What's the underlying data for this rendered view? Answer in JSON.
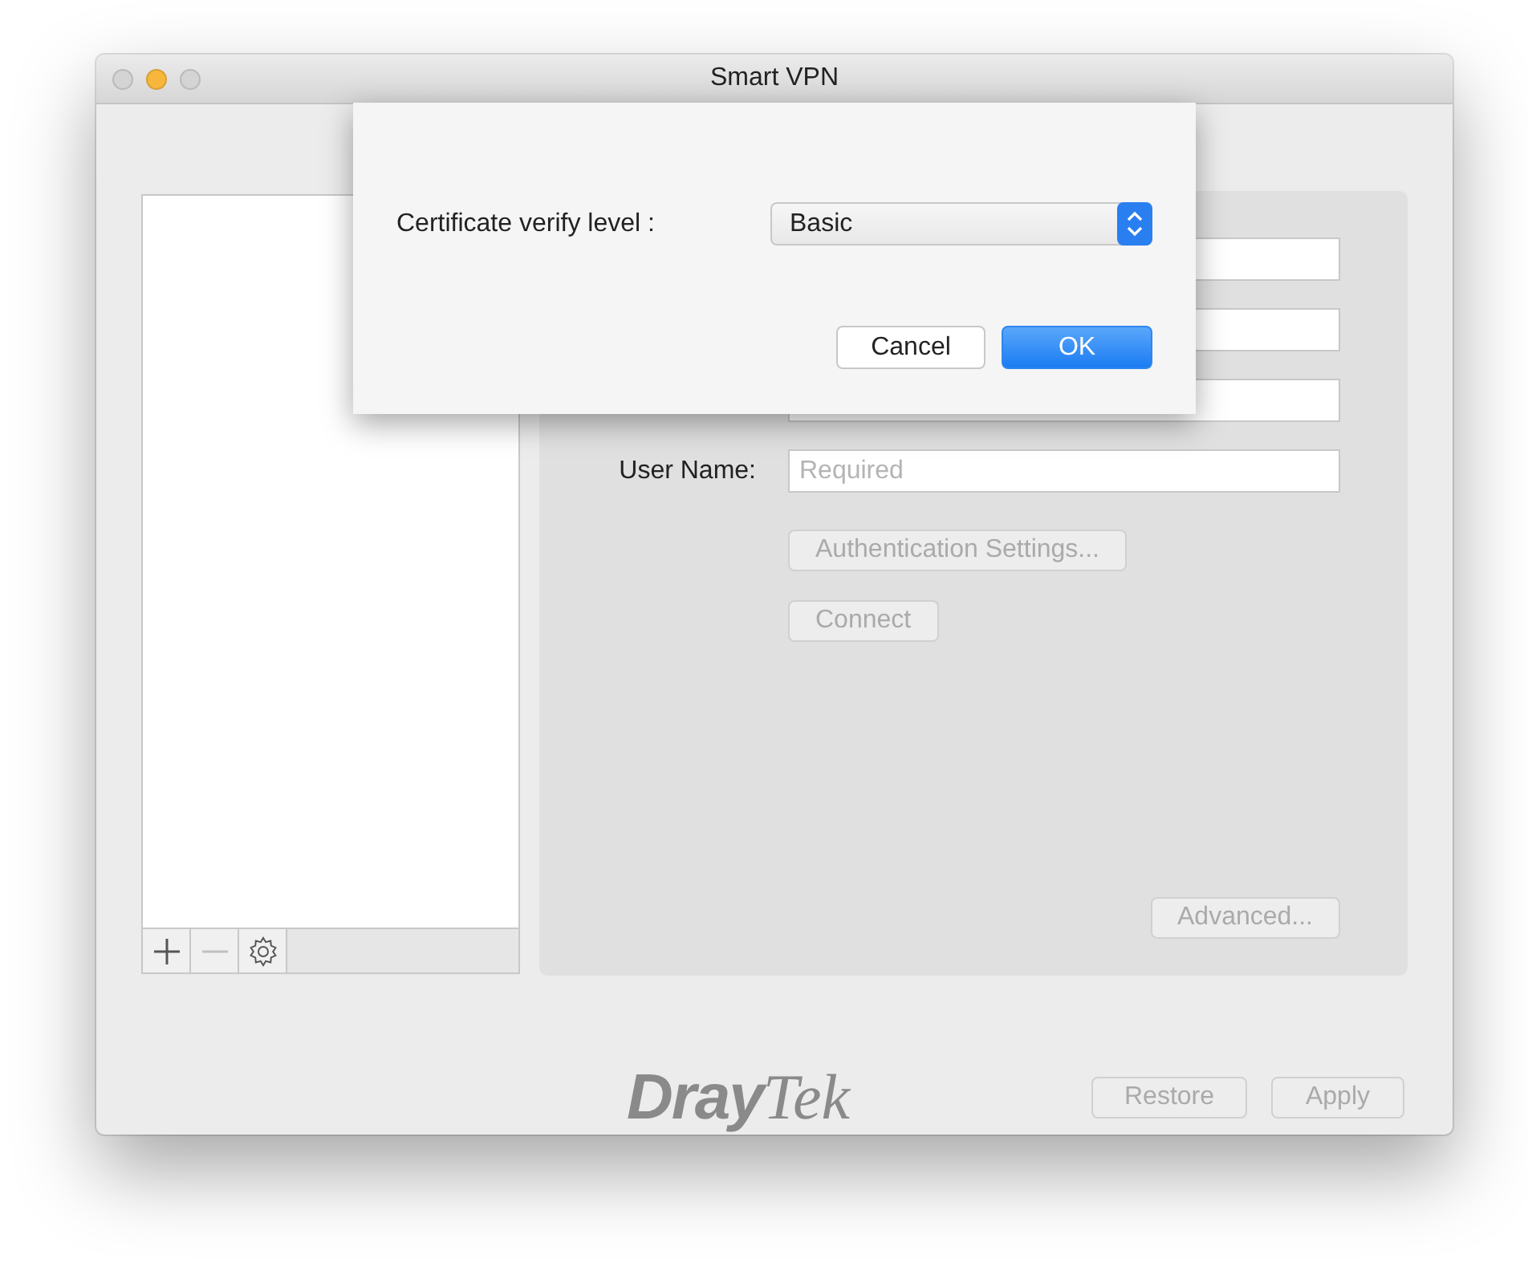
{
  "window": {
    "title": "Smart VPN"
  },
  "traffic_lights": [
    {
      "color": "#d4d4d4"
    },
    {
      "color": "#f6b73c"
    },
    {
      "color": "#d4d4d4"
    }
  ],
  "list_toolbar": [
    {
      "kind": "add",
      "disabled": false
    },
    {
      "kind": "remove",
      "disabled": true
    },
    {
      "kind": "gear",
      "disabled": false
    }
  ],
  "form": {
    "user_name": {
      "label": "User Name:",
      "placeholder": "Required"
    },
    "buttons": [
      {
        "label": "Authentication Settings...",
        "disabled": true
      },
      {
        "label": "Connect",
        "disabled": true
      }
    ],
    "advanced": {
      "label": "Advanced...",
      "disabled": true
    }
  },
  "logo": [
    "Dray",
    "Tek"
  ],
  "footer_buttons": [
    {
      "label": "Restore",
      "disabled": true
    },
    {
      "label": "Apply",
      "disabled": true
    }
  ],
  "sheet": {
    "label": "Certificate verify level :",
    "select": {
      "value": "Basic"
    },
    "buttons": [
      {
        "label": "Cancel",
        "default": false
      },
      {
        "label": "OK",
        "default": true
      }
    ]
  }
}
